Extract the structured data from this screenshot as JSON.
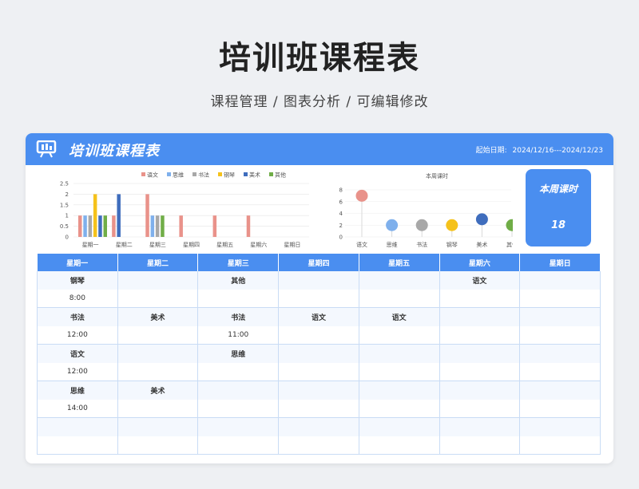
{
  "page": {
    "title": "培训班课程表",
    "subtitle": "课程管理 / 图表分析 / 可编辑修改"
  },
  "header": {
    "title": "培训班课程表",
    "date_label": "起始日期:",
    "date_range": "2024/12/16---2024/12/23",
    "icon": "presentation-board-icon"
  },
  "kpi": {
    "label": "本周课时",
    "value": "18"
  },
  "colors": {
    "accent": "#4a8ef0",
    "语文": "#e9928a",
    "思维": "#7fb0ec",
    "书法": "#a8a8a8",
    "钢琴": "#f5c21b",
    "美术": "#3f6dbd",
    "其他": "#70ad47"
  },
  "chart_data": [
    {
      "type": "bar",
      "title": "",
      "categories": [
        "星期一",
        "星期二",
        "星期三",
        "星期四",
        "星期五",
        "星期六",
        "星期日"
      ],
      "series": [
        {
          "name": "语文",
          "values": [
            1,
            1,
            2,
            1,
            1,
            1,
            0
          ]
        },
        {
          "name": "思维",
          "values": [
            1,
            0,
            1,
            0,
            0,
            0,
            0
          ]
        },
        {
          "name": "书法",
          "values": [
            1,
            0,
            1,
            0,
            0,
            0,
            0
          ]
        },
        {
          "name": "钢琴",
          "values": [
            2,
            0,
            0,
            0,
            0,
            0,
            0
          ]
        },
        {
          "name": "美术",
          "values": [
            1,
            2,
            0,
            0,
            0,
            0,
            0
          ]
        },
        {
          "name": "其他",
          "values": [
            1,
            0,
            1,
            0,
            0,
            0,
            0
          ]
        }
      ],
      "yticks": [
        "0",
        "0.5",
        "1",
        "1.5",
        "2",
        "2.5"
      ],
      "ylim": [
        0,
        2.5
      ],
      "legend": "top"
    },
    {
      "type": "scatter",
      "title": "本周课时",
      "categories": [
        "语文",
        "思维",
        "书法",
        "钢琴",
        "美术",
        "其他"
      ],
      "values": [
        7,
        2,
        2,
        2,
        3,
        2
      ],
      "yticks": [
        "0",
        "2",
        "4",
        "6",
        "8"
      ],
      "ylim": [
        0,
        8
      ]
    }
  ],
  "schedule": {
    "days": [
      "星期一",
      "星期二",
      "星期三",
      "星期四",
      "星期五",
      "星期六",
      "星期日"
    ],
    "rows": [
      {
        "subjects": [
          "钢琴",
          "",
          "其他",
          "",
          "",
          "语文",
          ""
        ],
        "times": [
          "8:00",
          "",
          "",
          "",
          "",
          "",
          ""
        ]
      },
      {
        "subjects": [
          "书法",
          "美术",
          "书法",
          "语文",
          "语文",
          "",
          ""
        ],
        "times": [
          "12:00",
          "",
          "11:00",
          "",
          "",
          "",
          ""
        ]
      },
      {
        "subjects": [
          "语文",
          "",
          "思维",
          "",
          "",
          "",
          ""
        ],
        "times": [
          "12:00",
          "",
          "",
          "",
          "",
          "",
          ""
        ]
      },
      {
        "subjects": [
          "思维",
          "美术",
          "",
          "",
          "",
          "",
          ""
        ],
        "times": [
          "14:00",
          "",
          "",
          "",
          "",
          "",
          ""
        ]
      },
      {
        "subjects": [
          "",
          "",
          "",
          "",
          "",
          "",
          ""
        ],
        "times": [
          "",
          "",
          "",
          "",
          "",
          "",
          ""
        ]
      }
    ]
  }
}
